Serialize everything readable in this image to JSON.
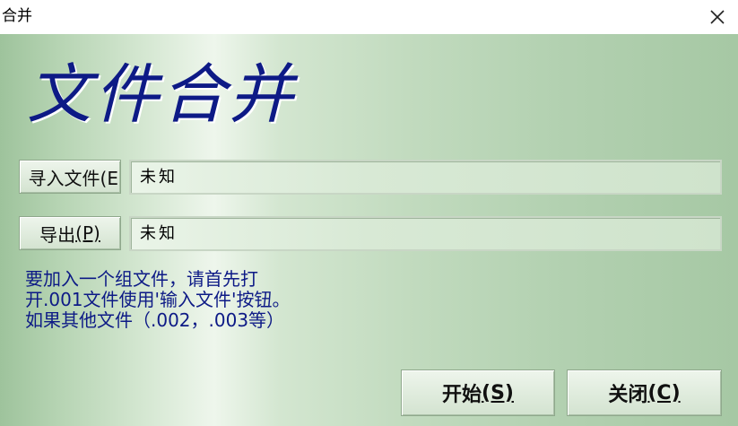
{
  "window": {
    "title": "合并"
  },
  "hero": {
    "title": "文件合并"
  },
  "input_row": {
    "button_label": "导入文件(F)",
    "button_display": "寻入文件(E",
    "value": "未知"
  },
  "output_row": {
    "button_label_main": "导出",
    "button_label_hotkey": "(P)",
    "value": "未知"
  },
  "info": {
    "lines": [
      "要加入一个组文件，请首先打",
      "开.001文件使用'输入文件'按钮。",
      "如果其他文件（.002，.003等）"
    ]
  },
  "actions": {
    "start_label": "开始",
    "start_hotkey": "(S)",
    "close_label": "关闭",
    "close_hotkey": "(C)"
  },
  "icons": {
    "close": "close-icon"
  },
  "colors": {
    "title_blue": "#0d1a86",
    "panel_green": "#b6d4b3"
  }
}
